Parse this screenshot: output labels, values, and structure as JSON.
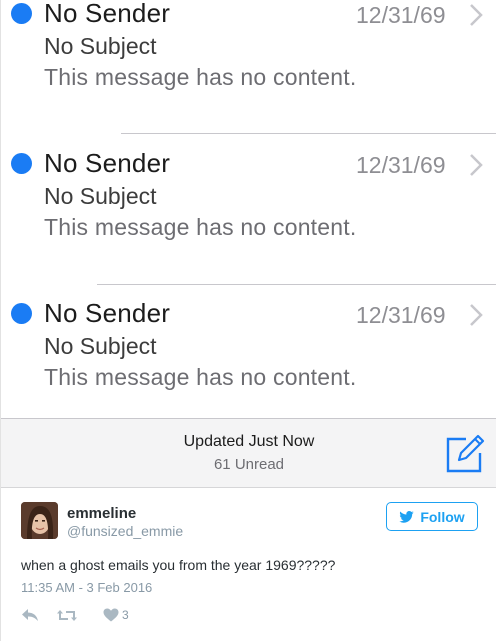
{
  "mail": {
    "items": [
      {
        "sender": "No Sender",
        "date": "12/31/69",
        "subject": "No Subject",
        "preview": "This message has no content."
      },
      {
        "sender": "No Sender",
        "date": "12/31/69",
        "subject": "No Subject",
        "preview": "This message has no content."
      },
      {
        "sender": "No Sender",
        "date": "12/31/69",
        "subject": "No Subject",
        "preview": "This message has no content."
      }
    ],
    "colors": {
      "unread_dot": "#1a7cf4",
      "accent": "#1a7cf4"
    }
  },
  "toolbar": {
    "status": "Updated Just Now",
    "unread": "61 Unread",
    "compose_icon": "compose-icon"
  },
  "tweet": {
    "name": "emmeline",
    "handle": "@funsized_emmie",
    "follow_label": "Follow",
    "text": "when a ghost emails you from the year 1969?????",
    "timestamp": "11:35 AM - 3 Feb 2016",
    "like_count": "3",
    "colors": {
      "brand": "#1da1f2"
    }
  }
}
